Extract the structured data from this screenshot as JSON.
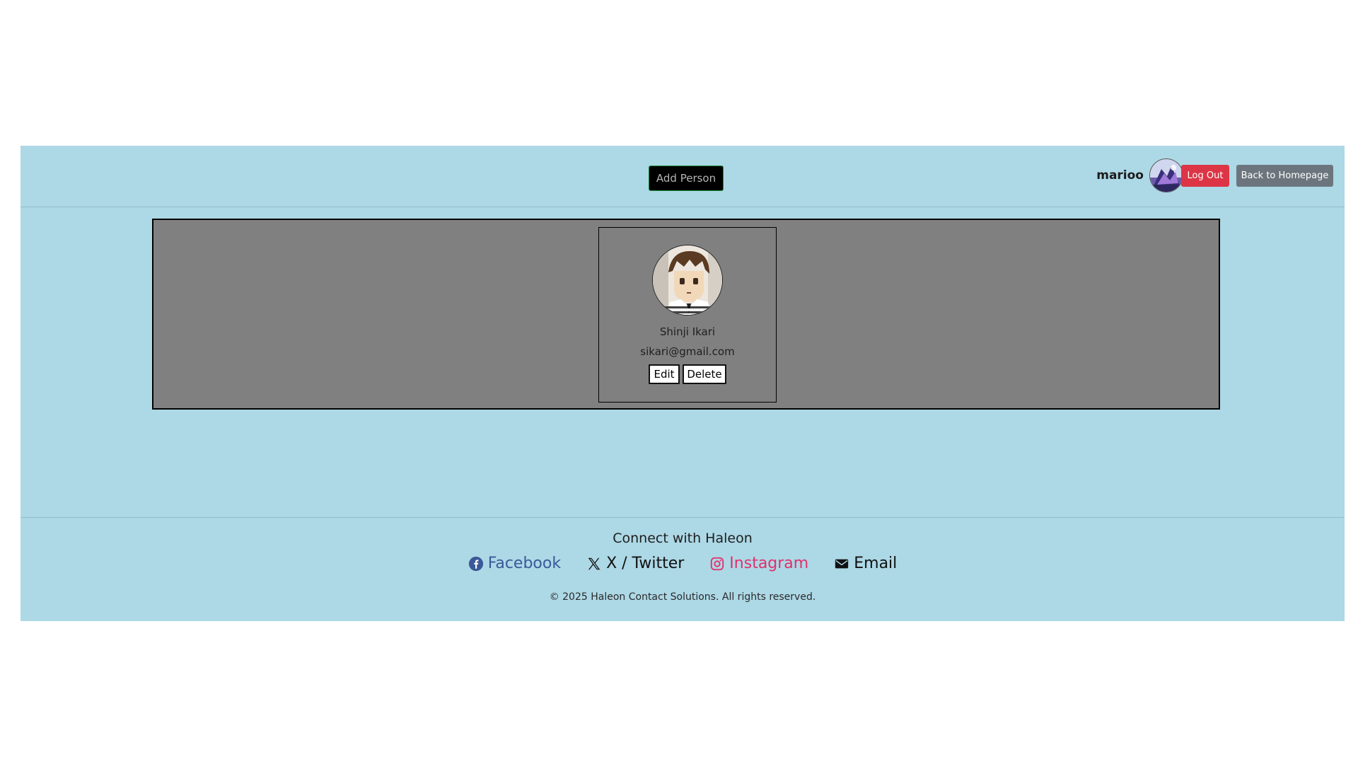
{
  "header": {
    "add_person_label": "Add Person",
    "username": "marioo",
    "logout_label": "Log Out",
    "home_label": "Back to Homepage"
  },
  "contacts": [
    {
      "name": "Shinji Ikari",
      "email": "sikari@gmail.com",
      "edit_label": "Edit",
      "delete_label": "Delete"
    }
  ],
  "footer": {
    "title": "Connect with Haleon",
    "links": [
      {
        "label": "Facebook",
        "icon": "facebook-icon",
        "color": "#3b5998"
      },
      {
        "label": "X / Twitter",
        "icon": "x-twitter-icon",
        "color": "#111111"
      },
      {
        "label": "Instagram",
        "icon": "instagram-icon",
        "color": "#e1306c"
      },
      {
        "label": "Email",
        "icon": "envelope-icon",
        "color": "#111111"
      }
    ],
    "copyright": "© 2025 Haleon Contact Solutions. All rights reserved."
  },
  "colors": {
    "page_background": "#add8e6",
    "panel_background": "#808080",
    "logout_button": "#dc3545",
    "home_button": "#6c757d",
    "add_person_button": "#000000"
  }
}
